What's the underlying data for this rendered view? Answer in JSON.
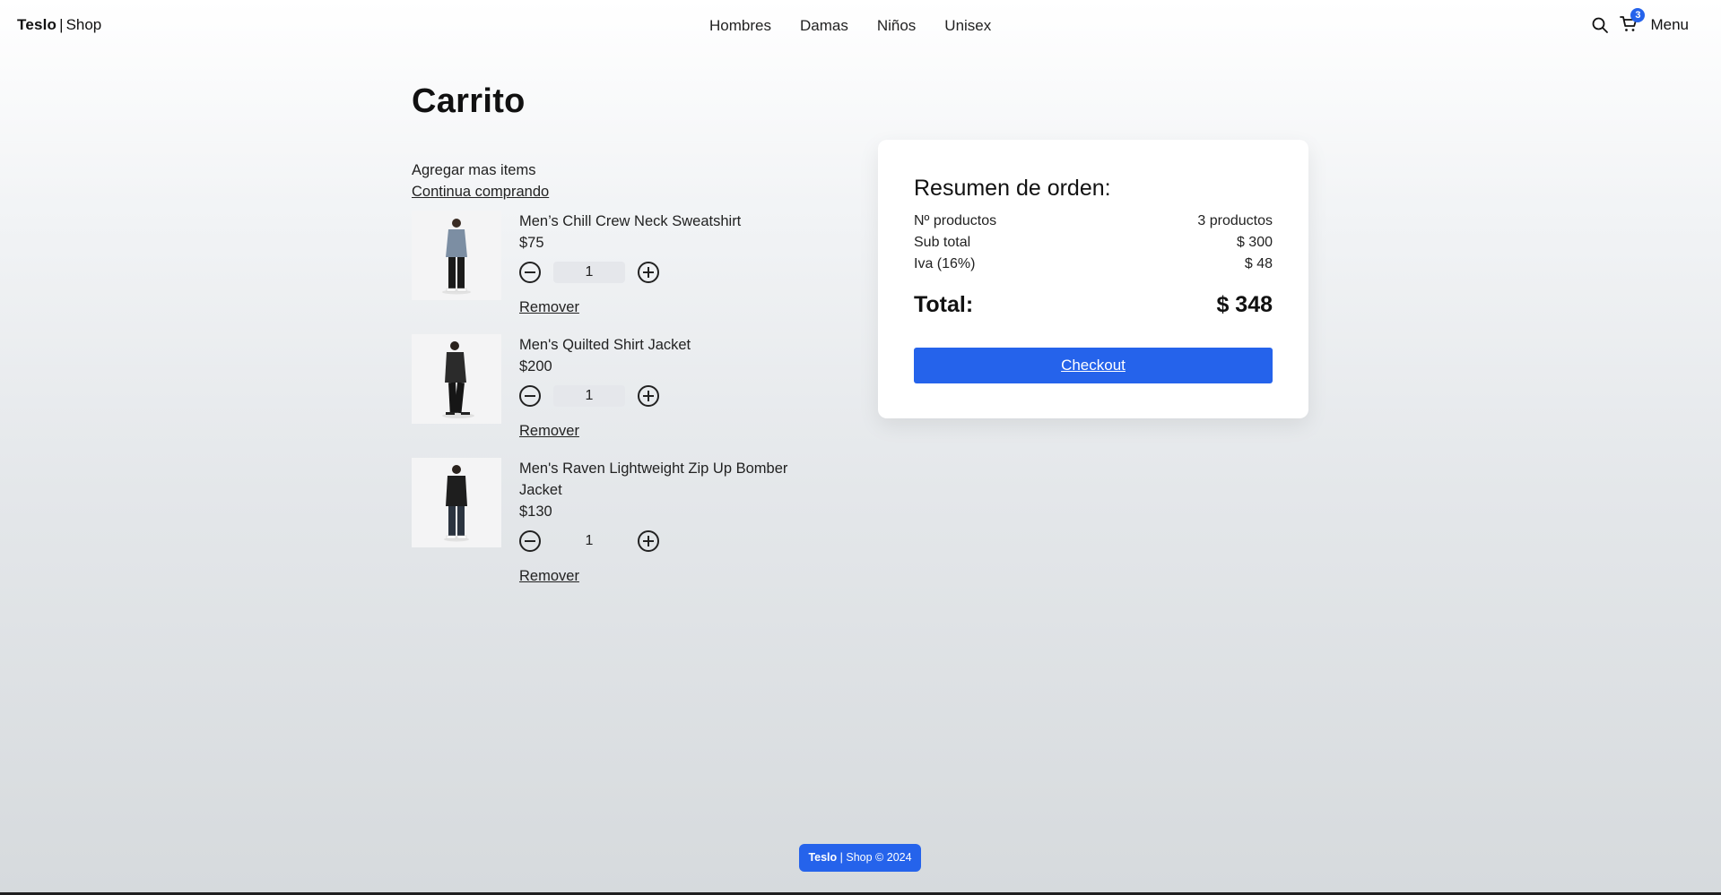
{
  "brand": {
    "name": "Teslo",
    "separator": "|",
    "suffix": "Shop"
  },
  "nav": {
    "links": [
      "Hombres",
      "Damas",
      "Niños",
      "Unisex"
    ],
    "menu_label": "Menu",
    "cart_count": "3"
  },
  "page": {
    "title": "Carrito",
    "add_more": "Agregar mas items",
    "continue_link": "Continua comprando"
  },
  "cart": {
    "items": [
      {
        "name": "Men’s Chill Crew Neck Sweatshirt",
        "price": "$75",
        "qty": "1",
        "remove": "Remover",
        "shirt_color": "#7c8ea3"
      },
      {
        "name": "Men's Quilted Shirt Jacket",
        "price": "$200",
        "qty": "1",
        "remove": "Remover",
        "shirt_color": "#2b2b2b"
      },
      {
        "name": "Men's Raven Lightweight Zip Up Bomber Jacket",
        "price": "$130",
        "qty": "1",
        "remove": "Remover",
        "shirt_color": "#1e1e1e"
      }
    ]
  },
  "summary": {
    "title": "Resumen de orden:",
    "rows": [
      {
        "label": "Nº productos",
        "value": "3 productos"
      },
      {
        "label": "Sub total",
        "value": "$ 300"
      },
      {
        "label": "Iva (16%)",
        "value": "$ 48"
      }
    ],
    "total_label": "Total:",
    "total_value": "$ 348",
    "checkout": "Checkout"
  },
  "footer": {
    "brand": "Teslo",
    "separator": "|",
    "text": "Shop © 2024"
  },
  "colors": {
    "accent": "#2563eb"
  }
}
